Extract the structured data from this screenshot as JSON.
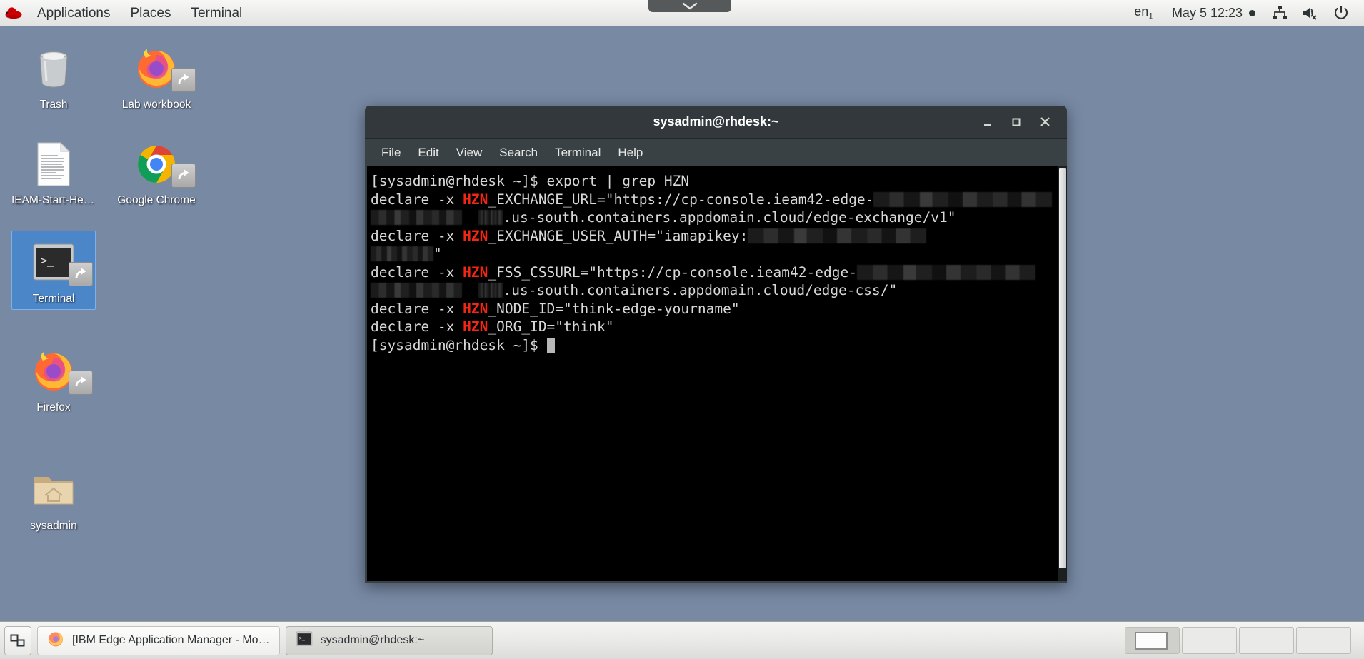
{
  "top_panel": {
    "logo_icon": "redhat-logo-icon",
    "menus": [
      {
        "label": "Applications",
        "name": "applications-menu"
      },
      {
        "label": "Places",
        "name": "places-menu"
      },
      {
        "label": "Terminal",
        "name": "terminal-menu"
      }
    ],
    "keyboard_layout": "en",
    "keyboard_layout_sub": "1",
    "clock": "May 5  12:23",
    "tray_icons": [
      "network-icon",
      "volume-muted-icon",
      "power-icon"
    ]
  },
  "vm_pulldown": {
    "icon": "chevron-down-icon"
  },
  "desktop": {
    "background_color": "#7889a4",
    "icons": [
      {
        "label": "Trash",
        "icon": "trash-icon",
        "selected": false
      },
      {
        "label": "Lab workbook",
        "icon": "firefox-shortcut-icon",
        "selected": false
      },
      {
        "label": "IEAM-Start-Her…",
        "icon": "document-icon",
        "selected": false
      },
      {
        "label": "Google Chrome",
        "icon": "chrome-shortcut-icon",
        "selected": false
      },
      {
        "label": "Terminal",
        "icon": "terminal-shortcut-icon",
        "selected": true
      },
      {
        "label": "Firefox",
        "icon": "firefox-shortcut-icon",
        "selected": false
      },
      {
        "label": "sysadmin",
        "icon": "home-folder-icon",
        "selected": false
      }
    ]
  },
  "terminal_window": {
    "title": "sysadmin@rhdesk:~",
    "menubar": [
      "File",
      "Edit",
      "View",
      "Search",
      "Terminal",
      "Help"
    ],
    "window_buttons": {
      "minimize": "–",
      "maximize": "□",
      "close": "✕"
    },
    "prompt": "[sysadmin@rhdesk ~]$",
    "command": "export | grep HZN",
    "match_highlight": "HZN",
    "match_color": "#f22613",
    "output_lines": [
      {
        "type": "command",
        "text": "[sysadmin@rhdesk ~]$ export | grep HZN"
      },
      {
        "type": "declare",
        "prefix": "declare -x ",
        "match": "HZN",
        "text": "_EXCHANGE_URL=\"https://cp-console.ieam42-edge-",
        "redacted": true
      },
      {
        "type": "wrap",
        "redacted_lead": true,
        "text": ".us-south.containers.appdomain.cloud/edge-exchange/v1\""
      },
      {
        "type": "declare",
        "prefix": "declare -x ",
        "match": "HZN",
        "text": "_EXCHANGE_USER_AUTH=\"iamapikey:",
        "redacted": true
      },
      {
        "type": "wrap",
        "redacted_lead": true,
        "text": "\""
      },
      {
        "type": "declare",
        "prefix": "declare -x ",
        "match": "HZN",
        "text": "_FSS_CSSURL=\"https://cp-console.ieam42-edge-",
        "redacted": true
      },
      {
        "type": "wrap",
        "redacted_lead": true,
        "text": ".us-south.containers.appdomain.cloud/edge-css/\""
      },
      {
        "type": "declare",
        "prefix": "declare -x ",
        "match": "HZN",
        "text": "_NODE_ID=\"think-edge-yourname\"",
        "redacted": false
      },
      {
        "type": "declare",
        "prefix": "declare -x ",
        "match": "HZN",
        "text": "_ORG_ID=\"think\"",
        "redacted": false
      },
      {
        "type": "prompt",
        "text": "[sysadmin@rhdesk ~]$ "
      }
    ],
    "scrollbar": "vertical-scrollbar"
  },
  "taskbar": {
    "show_desktop_icon": "show-desktop-icon",
    "items": [
      {
        "label": "[IBM Edge Application Manager - Mo…",
        "icon": "firefox-icon",
        "active": false
      },
      {
        "label": "sysadmin@rhdesk:~",
        "icon": "terminal-icon",
        "active": true
      }
    ],
    "workspaces": [
      {
        "name": "workspace-1",
        "active": true,
        "has_window": true
      },
      {
        "name": "workspace-2",
        "active": false,
        "has_window": false
      },
      {
        "name": "workspace-3",
        "active": false,
        "has_window": false
      },
      {
        "name": "workspace-4",
        "active": false,
        "has_window": false
      }
    ]
  }
}
